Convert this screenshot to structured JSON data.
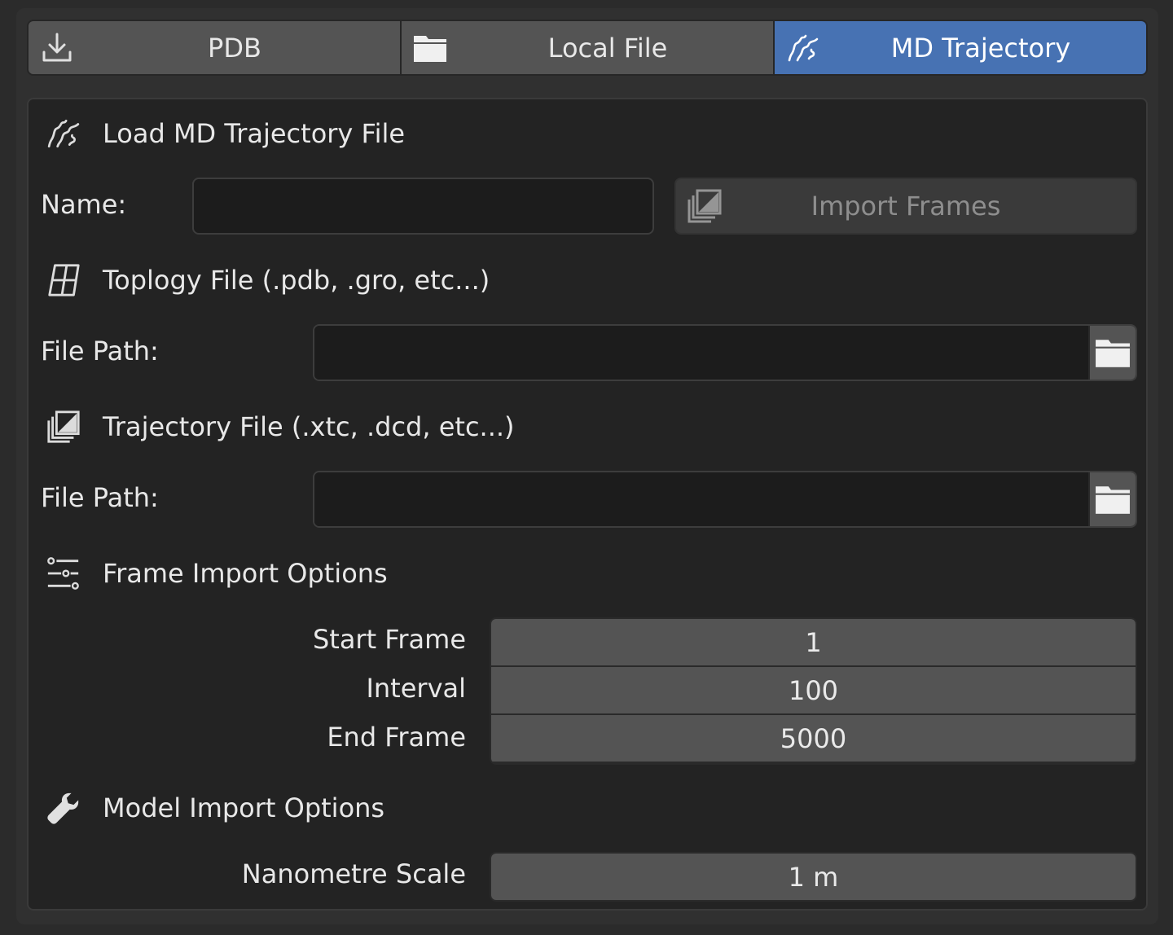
{
  "tabs": [
    {
      "label": "PDB",
      "icon": "download-icon",
      "active": false
    },
    {
      "label": "Local File",
      "icon": "folder-icon",
      "active": false
    },
    {
      "label": "MD Trajectory",
      "icon": "trajectory-icon",
      "active": true
    }
  ],
  "panel": {
    "title": "Load MD Trajectory File",
    "name_label": "Name:",
    "name_value": "",
    "import_button": "Import Frames",
    "topology": {
      "title": "Toplogy File (.pdb, .gro, etc...)",
      "path_label": "File Path:",
      "path_value": ""
    },
    "trajectory": {
      "title": "Trajectory File (.xtc, .dcd, etc...)",
      "path_label": "File Path:",
      "path_value": ""
    },
    "frame_options": {
      "title": "Frame Import Options",
      "fields": [
        {
          "label": "Start Frame",
          "value": "1"
        },
        {
          "label": "Interval",
          "value": "100"
        },
        {
          "label": "End Frame",
          "value": "5000"
        }
      ]
    },
    "model_options": {
      "title": "Model Import Options",
      "scale_label": "Nanometre Scale",
      "scale_value": "1 m"
    }
  },
  "colors": {
    "accent": "#4772b3",
    "panel_bg": "#232323",
    "field_bg": "#545454",
    "input_bg": "#1c1c1c"
  }
}
